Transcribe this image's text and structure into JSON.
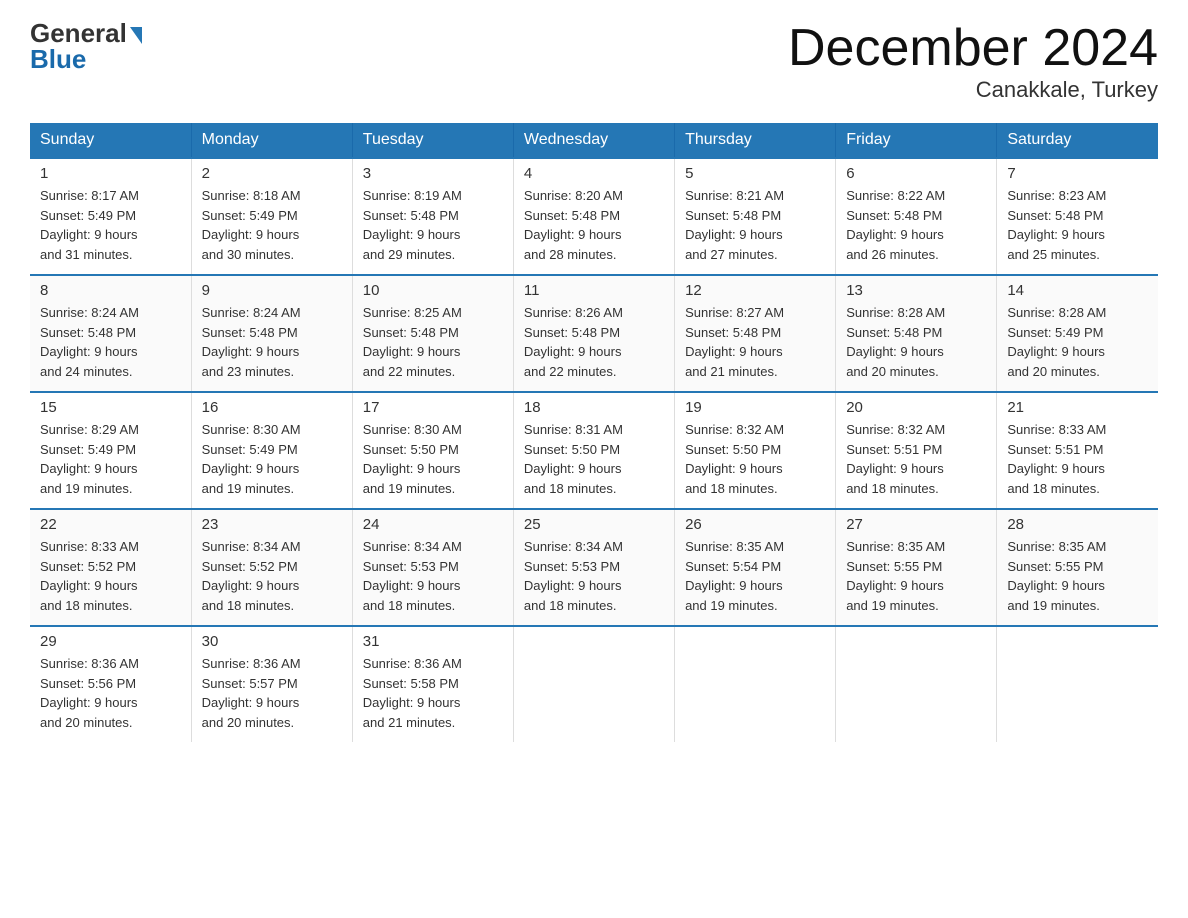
{
  "logo": {
    "general": "General",
    "blue": "Blue",
    "triangle": "▲"
  },
  "title": "December 2024",
  "location": "Canakkale, Turkey",
  "days_of_week": [
    "Sunday",
    "Monday",
    "Tuesday",
    "Wednesday",
    "Thursday",
    "Friday",
    "Saturday"
  ],
  "weeks": [
    [
      {
        "day": "1",
        "sunrise": "8:17 AM",
        "sunset": "5:49 PM",
        "daylight": "9 hours and 31 minutes."
      },
      {
        "day": "2",
        "sunrise": "8:18 AM",
        "sunset": "5:49 PM",
        "daylight": "9 hours and 30 minutes."
      },
      {
        "day": "3",
        "sunrise": "8:19 AM",
        "sunset": "5:48 PM",
        "daylight": "9 hours and 29 minutes."
      },
      {
        "day": "4",
        "sunrise": "8:20 AM",
        "sunset": "5:48 PM",
        "daylight": "9 hours and 28 minutes."
      },
      {
        "day": "5",
        "sunrise": "8:21 AM",
        "sunset": "5:48 PM",
        "daylight": "9 hours and 27 minutes."
      },
      {
        "day": "6",
        "sunrise": "8:22 AM",
        "sunset": "5:48 PM",
        "daylight": "9 hours and 26 minutes."
      },
      {
        "day": "7",
        "sunrise": "8:23 AM",
        "sunset": "5:48 PM",
        "daylight": "9 hours and 25 minutes."
      }
    ],
    [
      {
        "day": "8",
        "sunrise": "8:24 AM",
        "sunset": "5:48 PM",
        "daylight": "9 hours and 24 minutes."
      },
      {
        "day": "9",
        "sunrise": "8:24 AM",
        "sunset": "5:48 PM",
        "daylight": "9 hours and 23 minutes."
      },
      {
        "day": "10",
        "sunrise": "8:25 AM",
        "sunset": "5:48 PM",
        "daylight": "9 hours and 22 minutes."
      },
      {
        "day": "11",
        "sunrise": "8:26 AM",
        "sunset": "5:48 PM",
        "daylight": "9 hours and 22 minutes."
      },
      {
        "day": "12",
        "sunrise": "8:27 AM",
        "sunset": "5:48 PM",
        "daylight": "9 hours and 21 minutes."
      },
      {
        "day": "13",
        "sunrise": "8:28 AM",
        "sunset": "5:48 PM",
        "daylight": "9 hours and 20 minutes."
      },
      {
        "day": "14",
        "sunrise": "8:28 AM",
        "sunset": "5:49 PM",
        "daylight": "9 hours and 20 minutes."
      }
    ],
    [
      {
        "day": "15",
        "sunrise": "8:29 AM",
        "sunset": "5:49 PM",
        "daylight": "9 hours and 19 minutes."
      },
      {
        "day": "16",
        "sunrise": "8:30 AM",
        "sunset": "5:49 PM",
        "daylight": "9 hours and 19 minutes."
      },
      {
        "day": "17",
        "sunrise": "8:30 AM",
        "sunset": "5:50 PM",
        "daylight": "9 hours and 19 minutes."
      },
      {
        "day": "18",
        "sunrise": "8:31 AM",
        "sunset": "5:50 PM",
        "daylight": "9 hours and 18 minutes."
      },
      {
        "day": "19",
        "sunrise": "8:32 AM",
        "sunset": "5:50 PM",
        "daylight": "9 hours and 18 minutes."
      },
      {
        "day": "20",
        "sunrise": "8:32 AM",
        "sunset": "5:51 PM",
        "daylight": "9 hours and 18 minutes."
      },
      {
        "day": "21",
        "sunrise": "8:33 AM",
        "sunset": "5:51 PM",
        "daylight": "9 hours and 18 minutes."
      }
    ],
    [
      {
        "day": "22",
        "sunrise": "8:33 AM",
        "sunset": "5:52 PM",
        "daylight": "9 hours and 18 minutes."
      },
      {
        "day": "23",
        "sunrise": "8:34 AM",
        "sunset": "5:52 PM",
        "daylight": "9 hours and 18 minutes."
      },
      {
        "day": "24",
        "sunrise": "8:34 AM",
        "sunset": "5:53 PM",
        "daylight": "9 hours and 18 minutes."
      },
      {
        "day": "25",
        "sunrise": "8:34 AM",
        "sunset": "5:53 PM",
        "daylight": "9 hours and 18 minutes."
      },
      {
        "day": "26",
        "sunrise": "8:35 AM",
        "sunset": "5:54 PM",
        "daylight": "9 hours and 19 minutes."
      },
      {
        "day": "27",
        "sunrise": "8:35 AM",
        "sunset": "5:55 PM",
        "daylight": "9 hours and 19 minutes."
      },
      {
        "day": "28",
        "sunrise": "8:35 AM",
        "sunset": "5:55 PM",
        "daylight": "9 hours and 19 minutes."
      }
    ],
    [
      {
        "day": "29",
        "sunrise": "8:36 AM",
        "sunset": "5:56 PM",
        "daylight": "9 hours and 20 minutes."
      },
      {
        "day": "30",
        "sunrise": "8:36 AM",
        "sunset": "5:57 PM",
        "daylight": "9 hours and 20 minutes."
      },
      {
        "day": "31",
        "sunrise": "8:36 AM",
        "sunset": "5:58 PM",
        "daylight": "9 hours and 21 minutes."
      },
      {
        "day": "",
        "sunrise": "",
        "sunset": "",
        "daylight": ""
      },
      {
        "day": "",
        "sunrise": "",
        "sunset": "",
        "daylight": ""
      },
      {
        "day": "",
        "sunrise": "",
        "sunset": "",
        "daylight": ""
      },
      {
        "day": "",
        "sunrise": "",
        "sunset": "",
        "daylight": ""
      }
    ]
  ],
  "labels": {
    "sunrise": "Sunrise:",
    "sunset": "Sunset:",
    "daylight": "Daylight:"
  }
}
